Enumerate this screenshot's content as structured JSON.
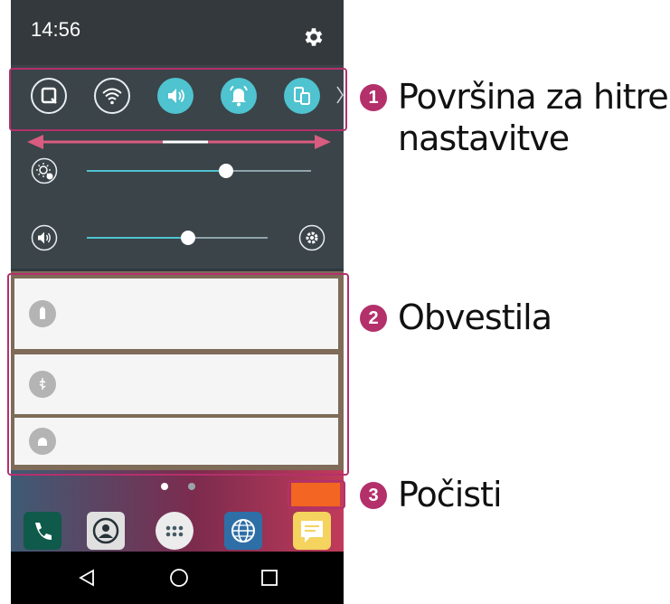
{
  "status_bar": {
    "time": "14:56",
    "settings_icon": "gear-icon"
  },
  "quick_settings": {
    "toggles": [
      {
        "name": "screenshot-icon",
        "state": "off"
      },
      {
        "name": "wifi-icon",
        "state": "off"
      },
      {
        "name": "sound-icon",
        "state": "on"
      },
      {
        "name": "notification-bell-icon",
        "state": "on"
      },
      {
        "name": "screen-rotation-icon",
        "state": "on"
      }
    ],
    "brightness_level": 0.62,
    "volume_level": 0.56
  },
  "notifications": [
    {
      "icon": "battery-charging-icon"
    },
    {
      "icon": "usb-icon"
    },
    {
      "icon": "android-debug-icon"
    }
  ],
  "navbar": {
    "icons": [
      "back-icon",
      "home-icon",
      "recents-icon"
    ]
  },
  "callouts": [
    {
      "number": "1",
      "label": "Površina za hitre nastavitve"
    },
    {
      "number": "2",
      "label": "Obvestila"
    },
    {
      "number": "3",
      "label": "Počisti"
    }
  ],
  "colors": {
    "accent": "#4fc3cf",
    "callout": "#b4306b",
    "clear_button": "#f26522"
  }
}
